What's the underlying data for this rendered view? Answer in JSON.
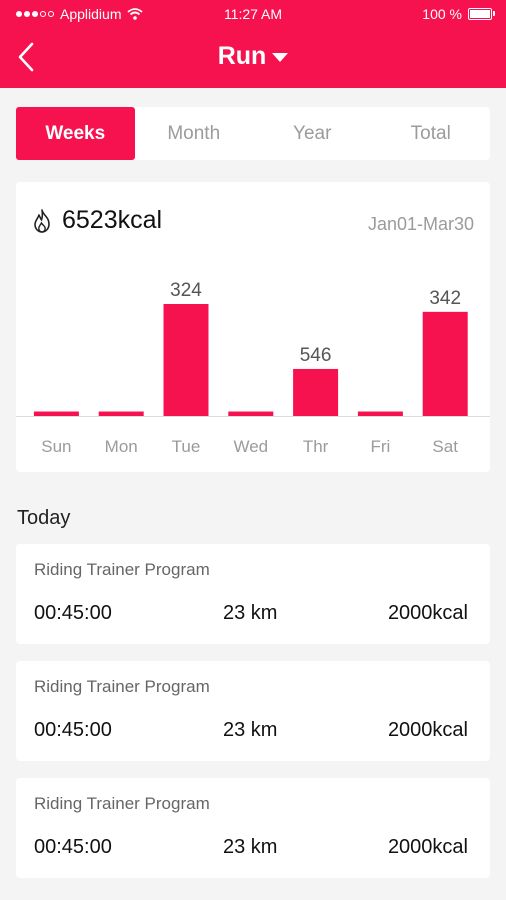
{
  "status_bar": {
    "carrier": "Applidium",
    "time": "11:27 AM",
    "battery_text": "100 %",
    "battery_level": 1.0
  },
  "nav": {
    "title": "Run",
    "back_icon": "chevron-left-icon",
    "dropdown_icon": "caret-down-icon"
  },
  "tabs": [
    {
      "label": "Weeks",
      "active": true
    },
    {
      "label": "Month",
      "active": false
    },
    {
      "label": "Year",
      "active": false
    },
    {
      "label": "Total",
      "active": false
    }
  ],
  "summary": {
    "icon": "flame-icon",
    "kcal": "6523kcal",
    "date_range": "Jan01-Mar30"
  },
  "chart_data": {
    "type": "bar",
    "categories": [
      "Sun",
      "Mon",
      "Tue",
      "Wed",
      "Thr",
      "Fri",
      "Sat"
    ],
    "values": [
      0,
      0,
      324,
      0,
      546,
      0,
      342
    ],
    "bar_heights_relative": [
      0.04,
      0.04,
      1.0,
      0.04,
      0.42,
      0.04,
      0.93
    ],
    "labels": [
      "",
      "",
      "324",
      "",
      "546",
      "",
      "342"
    ],
    "title": "",
    "xlabel": "",
    "ylabel": "",
    "grid": false,
    "bar_color": "#f5124f"
  },
  "today": {
    "title": "Today",
    "entries": [
      {
        "title": "Riding Trainer Program",
        "time": "00:45:00",
        "distance": "23 km",
        "kcal": "2000kcal"
      },
      {
        "title": "Riding Trainer Program",
        "time": "00:45:00",
        "distance": "23 km",
        "kcal": "2000kcal"
      },
      {
        "title": "Riding Trainer Program",
        "time": "00:45:00",
        "distance": "23 km",
        "kcal": "2000kcal"
      }
    ]
  },
  "colors": {
    "accent": "#f5124f",
    "background": "#f4f4f4",
    "muted_text": "#9b9b9b"
  }
}
